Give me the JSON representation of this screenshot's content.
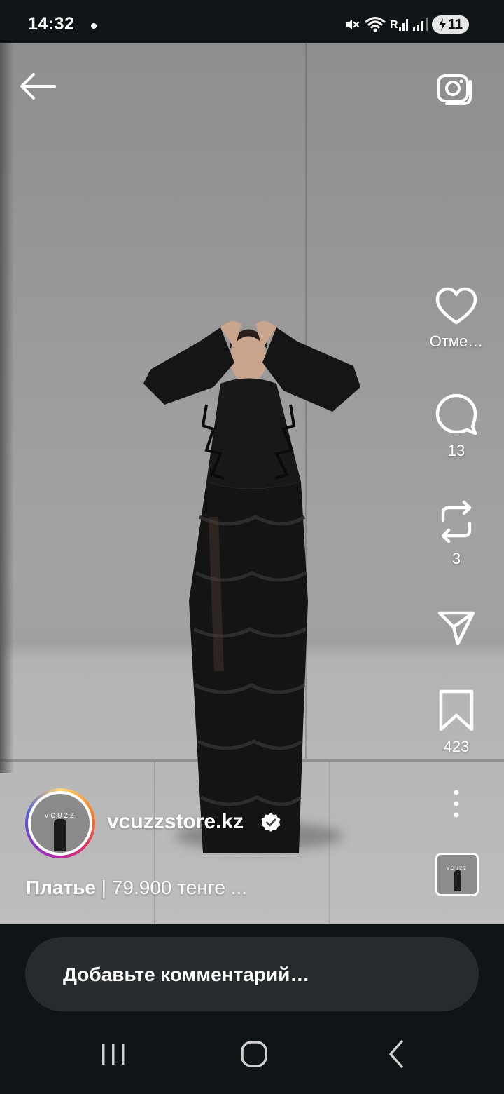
{
  "status_bar": {
    "time": "14:32",
    "battery": "11"
  },
  "post": {
    "username": "vcuzzstore.kz",
    "verified": true,
    "avatar_brand": "VCUZZ",
    "caption_bold": "Платье",
    "caption_rest": " | 79.900 тенге ...",
    "like_label": "Отме…",
    "comments_count": "13",
    "reposts_count": "3",
    "saves_count": "423",
    "audio_brand": "VCUZZ"
  },
  "comment_input": {
    "placeholder": "Добавьте комментарий…"
  },
  "colors": {
    "background": "#0f1517",
    "comment_box": "#262b2e",
    "overlay_text": "#ffffff"
  }
}
